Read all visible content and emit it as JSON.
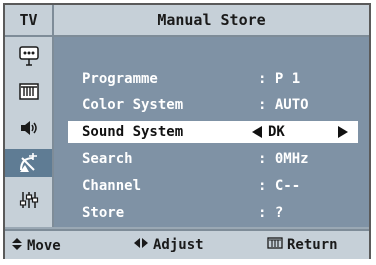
{
  "header": {
    "tv_label": "TV",
    "title": "Manual Store"
  },
  "sidebar": {
    "icons": [
      "input-icon",
      "picture-icon",
      "sound-icon",
      "channel-icon",
      "setup-icon"
    ],
    "active": "channel-icon"
  },
  "menu": {
    "items": [
      {
        "label": "Programme",
        "value": ": P 1"
      },
      {
        "label": "Color System",
        "value": ": AUTO"
      },
      {
        "label": "Sound System",
        "value": "DK",
        "selected": true
      },
      {
        "label": "Search",
        "value": ":  0MHz"
      },
      {
        "label": "Channel",
        "value": ": C--"
      },
      {
        "label": "Store",
        "value": ": ?"
      }
    ]
  },
  "footer": {
    "move_label": "Move",
    "adjust_label": "Adjust",
    "return_label": "Return"
  },
  "colors": {
    "content_bg": "#7f92a5",
    "panel_bg": "#c6d0d8",
    "active_icon_bg": "#5f7c94",
    "selected_row_bg": "#ffffff"
  }
}
